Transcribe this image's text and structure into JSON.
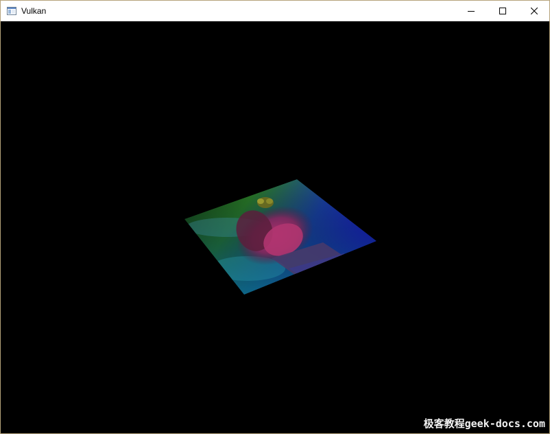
{
  "window": {
    "title": "Vulkan",
    "border_color": "#b5a27a",
    "icons": {
      "app": "app-window-icon",
      "minimize": "minimize-icon",
      "maximize": "maximize-icon",
      "close": "close-icon"
    }
  },
  "viewport": {
    "background": "#000000",
    "content": "textured-quad-render",
    "gradient_colors": [
      "#2f7a2a",
      "#1c1cc8",
      "#0d5a7a",
      "#8a1f6a"
    ]
  },
  "watermark": {
    "text": "极客教程geek-docs.com"
  }
}
